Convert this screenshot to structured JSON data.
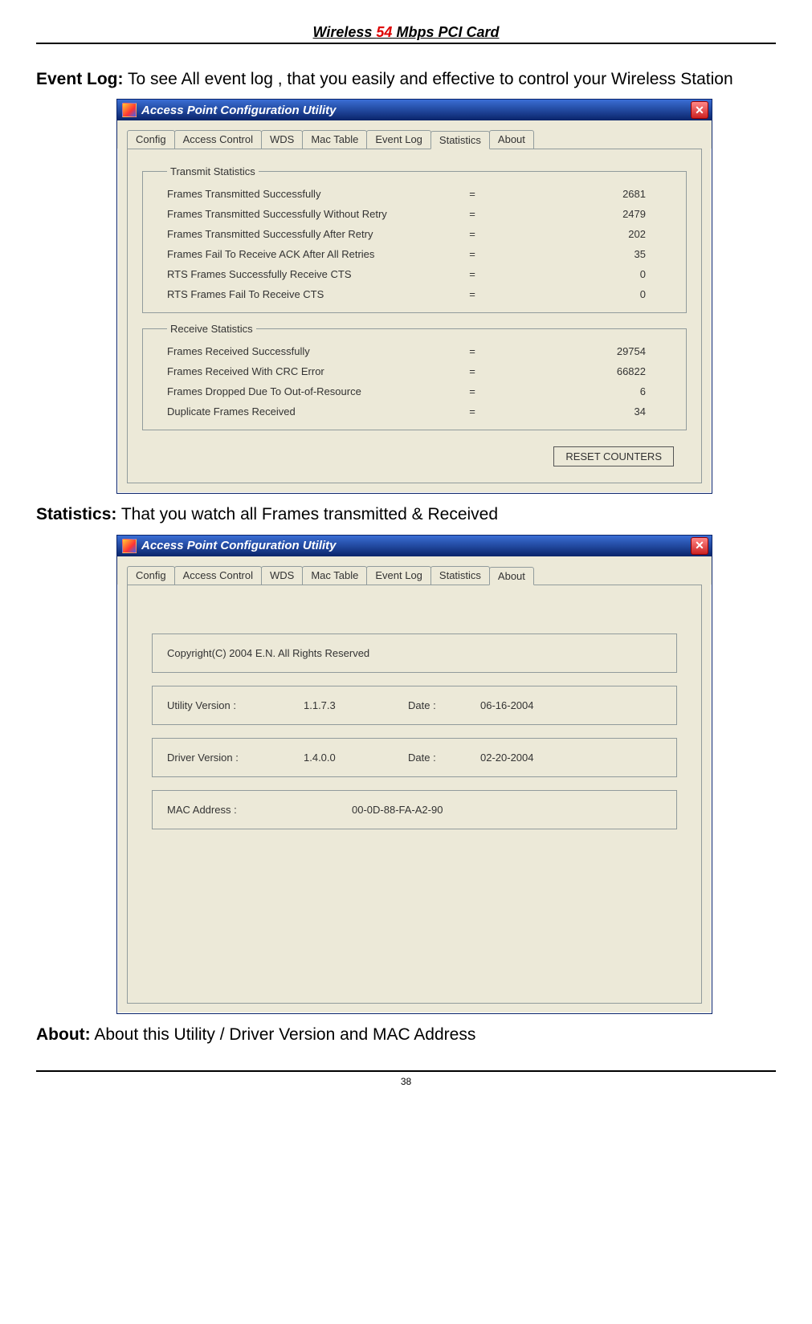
{
  "page": {
    "header_pre": "Wireless ",
    "header_red": "54",
    "header_post": " Mbps PCI Card",
    "page_number": "38"
  },
  "sections": {
    "event_log_label": "Event Log:",
    "event_log_text": " To see All event log , that you easily and effective to control your Wireless Station",
    "statistics_label": "Statistics:",
    "statistics_text": " That you watch all Frames transmitted & Received",
    "about_label": "About:",
    "about_text": " About this Utility / Driver Version and MAC Address"
  },
  "window_title": "Access Point Configuration Utility",
  "tabs": [
    "Config",
    "Access Control",
    "WDS",
    "Mac Table",
    "Event Log",
    "Statistics",
    "About"
  ],
  "stats_window": {
    "active_tab": "Statistics",
    "transmit_legend": "Transmit Statistics",
    "receive_legend": "Receive Statistics",
    "transmit_rows": [
      {
        "label": "Frames Transmitted Successfully",
        "value": "2681"
      },
      {
        "label": "Frames Transmitted Successfully Without Retry",
        "value": "2479"
      },
      {
        "label": "Frames Transmitted Successfully After Retry",
        "value": "202"
      },
      {
        "label": "Frames Fail To Receive ACK After All Retries",
        "value": "35"
      },
      {
        "label": "RTS Frames Successfully Receive CTS",
        "value": "0"
      },
      {
        "label": "RTS Frames Fail To Receive CTS",
        "value": "0"
      }
    ],
    "receive_rows": [
      {
        "label": "Frames Received Successfully",
        "value": "29754"
      },
      {
        "label": "Frames Received With CRC Error",
        "value": "66822"
      },
      {
        "label": "Frames Dropped Due To Out-of-Resource",
        "value": "6"
      },
      {
        "label": "Duplicate Frames Received",
        "value": "34"
      }
    ],
    "reset_button": "RESET COUNTERS"
  },
  "about_window": {
    "active_tab": "About",
    "copyright": "Copyright(C) 2004 E.N. All Rights Reserved",
    "utility_label": "Utility Version :",
    "utility_value": "1.1.7.3",
    "utility_date_label": "Date :",
    "utility_date_value": "06-16-2004",
    "driver_label": "Driver Version :",
    "driver_value": "1.4.0.0",
    "driver_date_label": "Date :",
    "driver_date_value": "02-20-2004",
    "mac_label": "MAC Address :",
    "mac_value": "00-0D-88-FA-A2-90"
  }
}
